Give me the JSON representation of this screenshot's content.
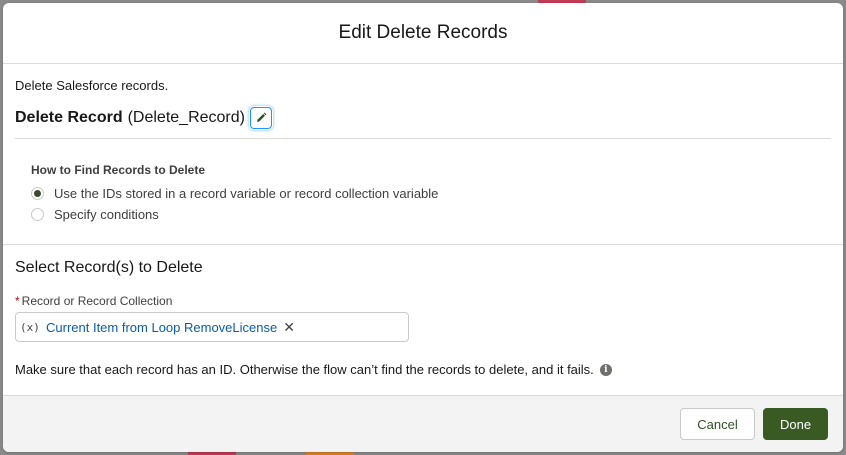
{
  "modal": {
    "title": "Edit Delete Records",
    "description": "Delete Salesforce records.",
    "element_label": "Delete Record",
    "element_api_name": "(Delete_Record)"
  },
  "find_records": {
    "label": "How to Find Records to Delete",
    "options": [
      {
        "label": "Use the IDs stored in a record variable or record collection variable",
        "selected": true
      },
      {
        "label": "Specify conditions",
        "selected": false
      }
    ]
  },
  "select_records": {
    "title": "Select Record(s) to Delete",
    "field_label": "Record or Record Collection",
    "required_marker": "*",
    "pill_icon": "(x)",
    "pill_value": "Current Item from Loop RemoveLicense",
    "help_text": "Make sure that each record has an ID. Otherwise the flow can’t find the records to delete, and it fails."
  },
  "footer": {
    "cancel_label": "Cancel",
    "done_label": "Done"
  }
}
